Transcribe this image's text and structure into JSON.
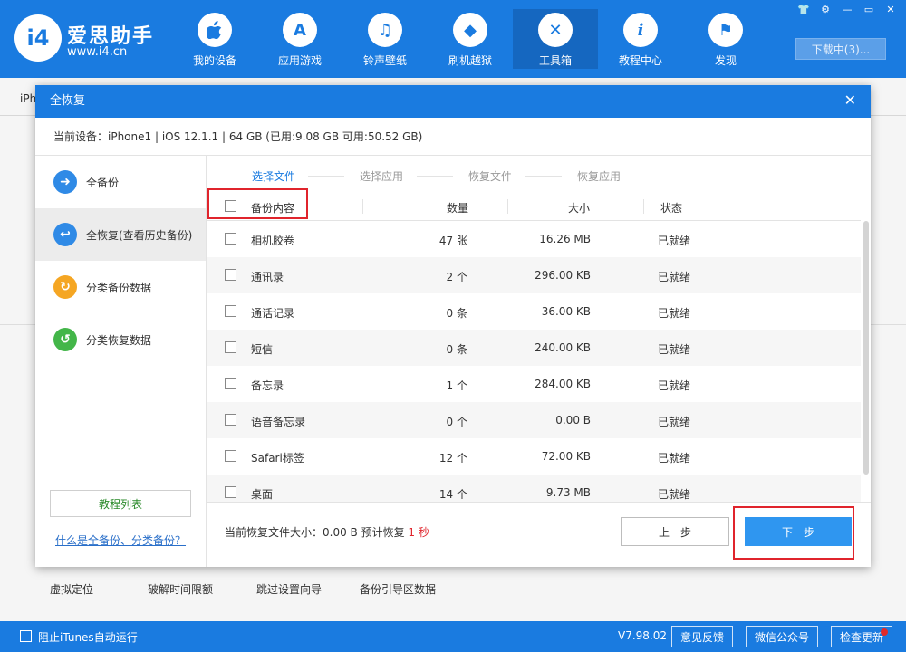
{
  "app": {
    "brand_title": "爱思助手",
    "brand_url": "www.i4.cn",
    "logo_text": "i4"
  },
  "nav": [
    {
      "label": "我的设备",
      "icon": "apple-icon",
      "glyph": ""
    },
    {
      "label": "应用游戏",
      "icon": "app-store-icon",
      "glyph": "A"
    },
    {
      "label": "铃声壁纸",
      "icon": "music-icon",
      "glyph": "♫"
    },
    {
      "label": "刷机越狱",
      "icon": "dropbox-icon",
      "glyph": "◆"
    },
    {
      "label": "工具箱",
      "icon": "tools-icon",
      "glyph": "✕"
    },
    {
      "label": "教程中心",
      "icon": "info-icon",
      "glyph": "i"
    },
    {
      "label": "发现",
      "icon": "flag-icon",
      "glyph": "⚑"
    }
  ],
  "nav_active": "工具箱",
  "download_label": "下载中(3)...",
  "window_controls": [
    "👕",
    "⚙",
    "—",
    "▭",
    "✕"
  ],
  "background": {
    "tab_label": "iPh",
    "tools": [
      "虚拟定位",
      "破解时间限额",
      "跳过设置向导",
      "备份引导区数据"
    ]
  },
  "dialog": {
    "title": "全恢复",
    "close_glyph": "✕",
    "device_info": "当前设备：iPhone1  |  iOS 12.1.1  |  64 GB (已用:9.08 GB 可用:50.52 GB)",
    "sidebar": [
      {
        "label": "全备份",
        "icon": "arrow-right-icon",
        "glyph": "➜",
        "color": "#2f8ae6"
      },
      {
        "label": "全恢复(查看历史备份)",
        "icon": "arrow-left-icon",
        "glyph": "↩",
        "color": "#2f8ae6"
      },
      {
        "label": "分类备份数据",
        "icon": "category-backup-icon",
        "glyph": "↻",
        "color": "#f5a623"
      },
      {
        "label": "分类恢复数据",
        "icon": "category-restore-icon",
        "glyph": "↺",
        "color": "#43b649"
      }
    ],
    "tutorial_button": "教程列表",
    "help_link": "什么是全备份、分类备份？",
    "steps": [
      "选择文件",
      "选择应用",
      "恢复文件",
      "恢复应用"
    ],
    "table": {
      "headers": {
        "content": "备份内容",
        "count": "数量",
        "size": "大小",
        "status": "状态"
      },
      "rows": [
        {
          "name": "相机胶卷",
          "count": "47 张",
          "size": "16.26 MB",
          "status": "已就绪"
        },
        {
          "name": "通讯录",
          "count": "2 个",
          "size": "296.00 KB",
          "status": "已就绪"
        },
        {
          "name": "通话记录",
          "count": "0 条",
          "size": "36.00 KB",
          "status": "已就绪"
        },
        {
          "name": "短信",
          "count": "0 条",
          "size": "240.00 KB",
          "status": "已就绪"
        },
        {
          "name": "备忘录",
          "count": "1 个",
          "size": "284.00 KB",
          "status": "已就绪"
        },
        {
          "name": "语音备忘录",
          "count": "0 个",
          "size": "0.00 B",
          "status": "已就绪"
        },
        {
          "name": "Safari标签",
          "count": "12 个",
          "size": "72.00 KB",
          "status": "已就绪"
        },
        {
          "name": "桌面",
          "count": "14 个",
          "size": "9.73 MB",
          "status": "已就绪"
        }
      ]
    },
    "footer": {
      "size_prefix": "当前恢复文件大小：",
      "size_value": "0.00 B",
      "eta_prefix": " 预计恢复 ",
      "eta_value": "1 秒"
    },
    "prev_button": "上一步",
    "next_button": "下一步"
  },
  "statusbar": {
    "itunes_label": "阻止iTunes自动运行",
    "version": "V7.98.02",
    "buttons": [
      "意见反馈",
      "微信公众号",
      "检查更新"
    ]
  },
  "colors": {
    "accent": "#1a7be0",
    "highlight": "#e0242c",
    "next_button": "#2f96f0"
  }
}
